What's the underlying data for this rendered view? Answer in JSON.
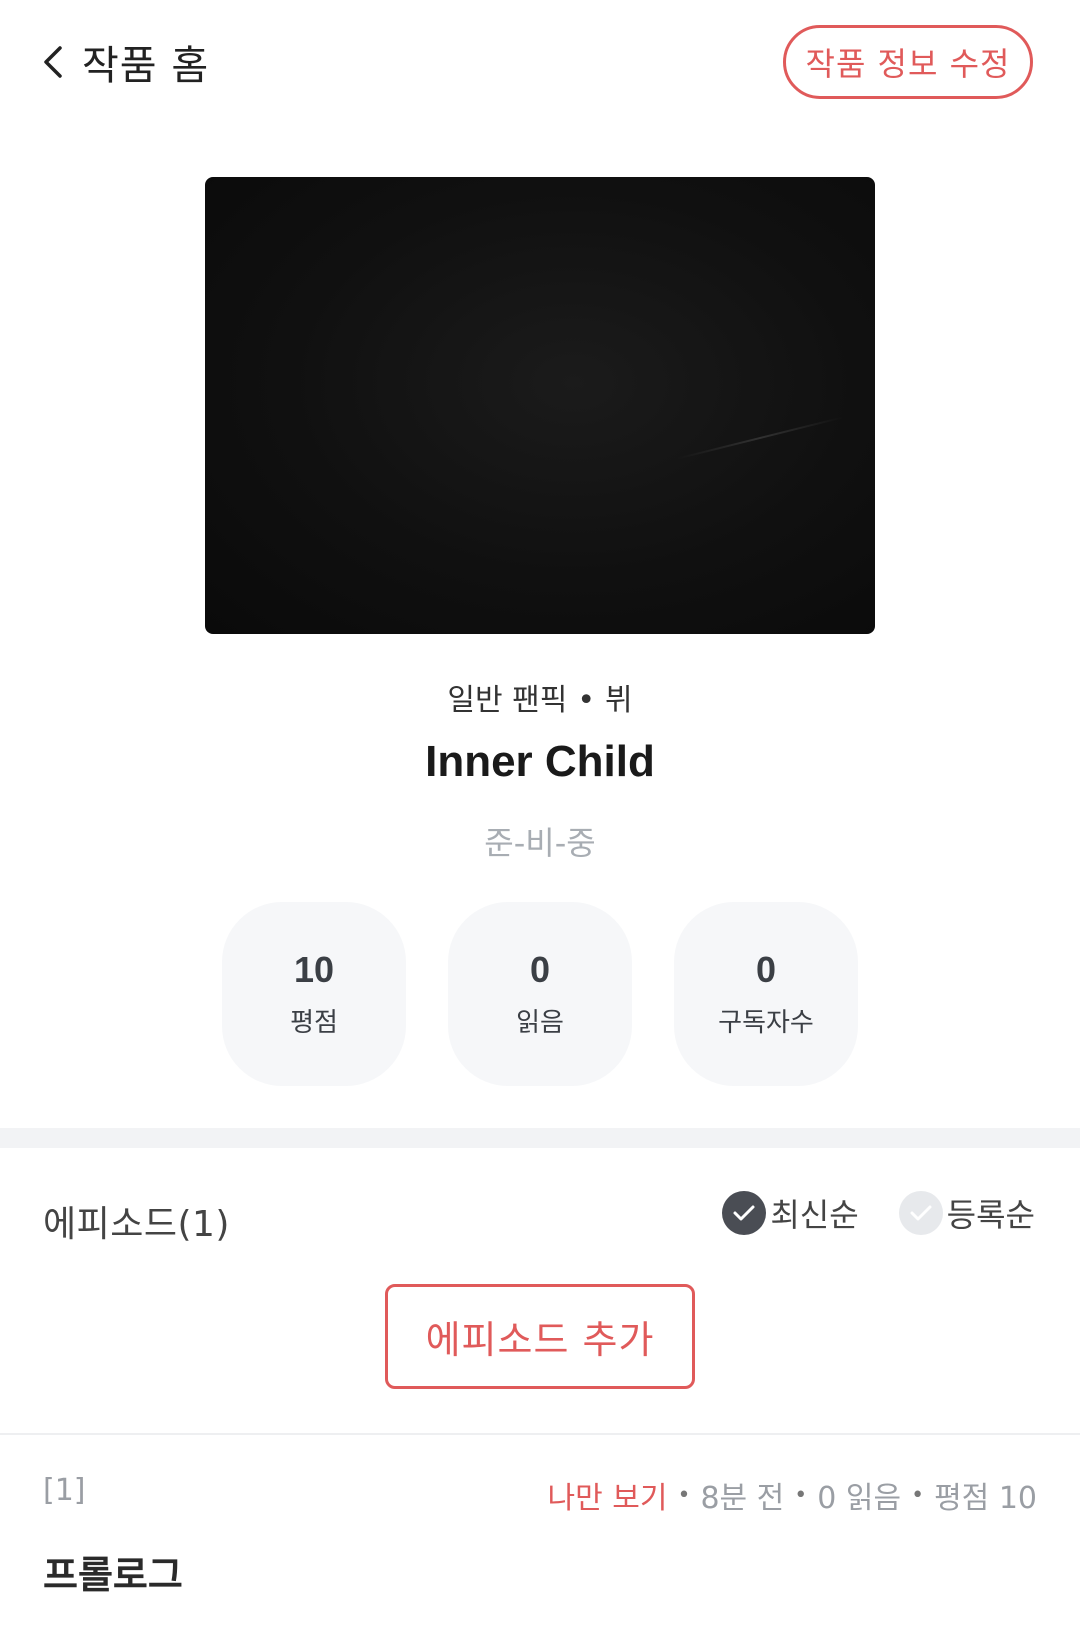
{
  "header": {
    "title": "작품 홈",
    "edit_button": "작품 정보 수정"
  },
  "work": {
    "category": "일반 팬픽",
    "pairing": "뷔",
    "title": "Inner Child",
    "status": "준-비-중"
  },
  "stats": [
    {
      "value": "10",
      "label": "평점"
    },
    {
      "value": "0",
      "label": "읽음"
    },
    {
      "value": "0",
      "label": "구독자수"
    }
  ],
  "episodes": {
    "heading": "에피소드(1)",
    "sort": {
      "latest": "최신순",
      "registered": "등록순",
      "selected": "latest"
    },
    "add_button": "에피소드 추가",
    "items": [
      {
        "number": "[1]",
        "visibility": "나만 보기",
        "time": "8분 전",
        "reads": "0 읽음",
        "rating": "평점 10",
        "title": "프롤로그"
      }
    ]
  },
  "colors": {
    "accent": "#e05a5a",
    "muted": "#a8adb3",
    "card_bg": "#f6f7f9"
  }
}
